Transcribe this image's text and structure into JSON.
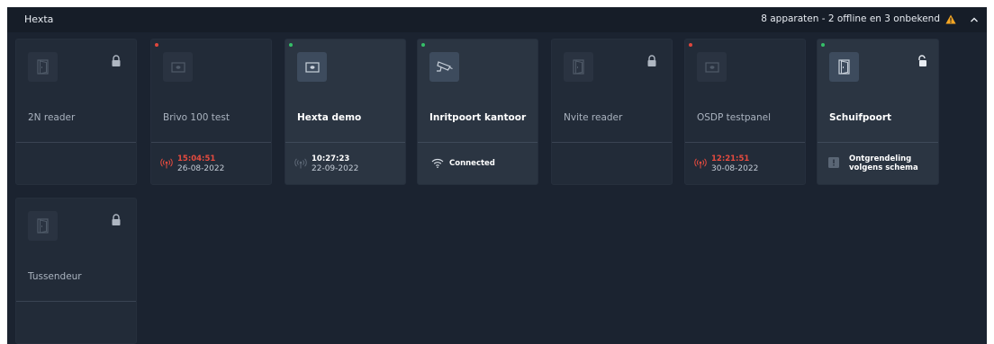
{
  "group": {
    "title": "Hexta",
    "summary": "8 apparaten - 2 offline en 3 onbekend",
    "warning_icon": "warning-triangle-icon",
    "collapse_icon": "chevron-up-icon",
    "warning_color": "#f5a623"
  },
  "devices": [
    {
      "name": "2N reader",
      "status": "unknown",
      "icon": "door-icon",
      "lock": "locked"
    },
    {
      "name": "Brivo 100 test",
      "status": "offline",
      "icon": "panel-icon",
      "last_seen_time": "15:04:51",
      "last_seen_date": "26-08-2022"
    },
    {
      "name": "Hexta demo",
      "status": "online",
      "icon": "panel-icon",
      "last_seen_time": "10:27:23",
      "last_seen_date": "22-09-2022"
    },
    {
      "name": "Inritpoort kantoor",
      "status": "online",
      "icon": "camera-icon",
      "connection": "Connected"
    },
    {
      "name": "Nvite reader",
      "status": "unknown",
      "icon": "door-icon",
      "lock": "locked"
    },
    {
      "name": "OSDP testpanel",
      "status": "offline",
      "icon": "panel-icon",
      "last_seen_time": "12:21:51",
      "last_seen_date": "30-08-2022"
    },
    {
      "name": "Schuifpoort",
      "status": "online",
      "icon": "door-icon",
      "lock": "unlocked",
      "schedule": "Ontgrendeling volgens schema"
    },
    {
      "name": "Tussendeur",
      "status": "unknown",
      "icon": "door-icon",
      "lock": "locked"
    }
  ],
  "colors": {
    "offline": "#e0463c",
    "online": "#35c068"
  }
}
